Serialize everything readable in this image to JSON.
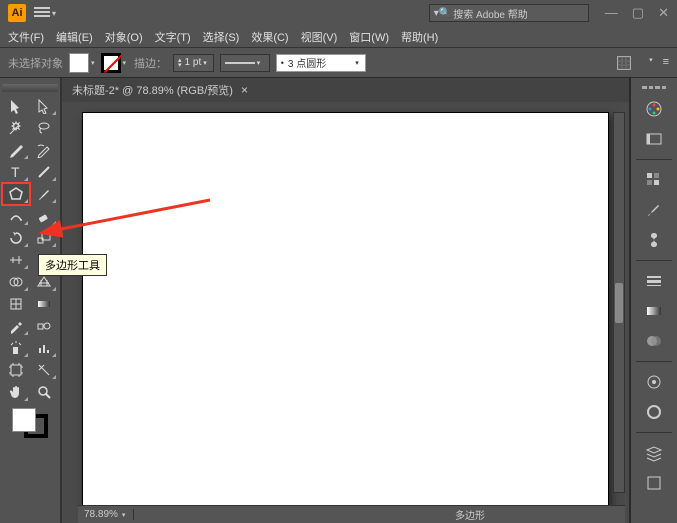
{
  "titlebar": {
    "logo": "Ai",
    "search_placeholder": "搜索 Adobe 帮助",
    "search_icon": "🔍",
    "controls": {
      "min": "—",
      "max": "▢",
      "close": "✕"
    }
  },
  "menubar": {
    "file": "文件(F)",
    "edit": "编辑(E)",
    "object": "对象(O)",
    "type": "文字(T)",
    "select": "选择(S)",
    "effect": "效果(C)",
    "view": "视图(V)",
    "window": "窗口(W)",
    "help": "帮助(H)"
  },
  "controlbar": {
    "no_selection": "未选择对象",
    "stroke_label": "描边：",
    "stroke_value": "1 pt",
    "style_value": "3 点圆形"
  },
  "document": {
    "tab_title": "未标题-2* @ 78.89% (RGB/预览)",
    "close_x": "×"
  },
  "tooltip": {
    "polygon_tool": "多边形工具"
  },
  "statusbar": {
    "zoom": "78.89%",
    "current_tool": "多边形"
  },
  "icons": {
    "dropdown": "▾",
    "up": "▴",
    "menu": "≡"
  }
}
